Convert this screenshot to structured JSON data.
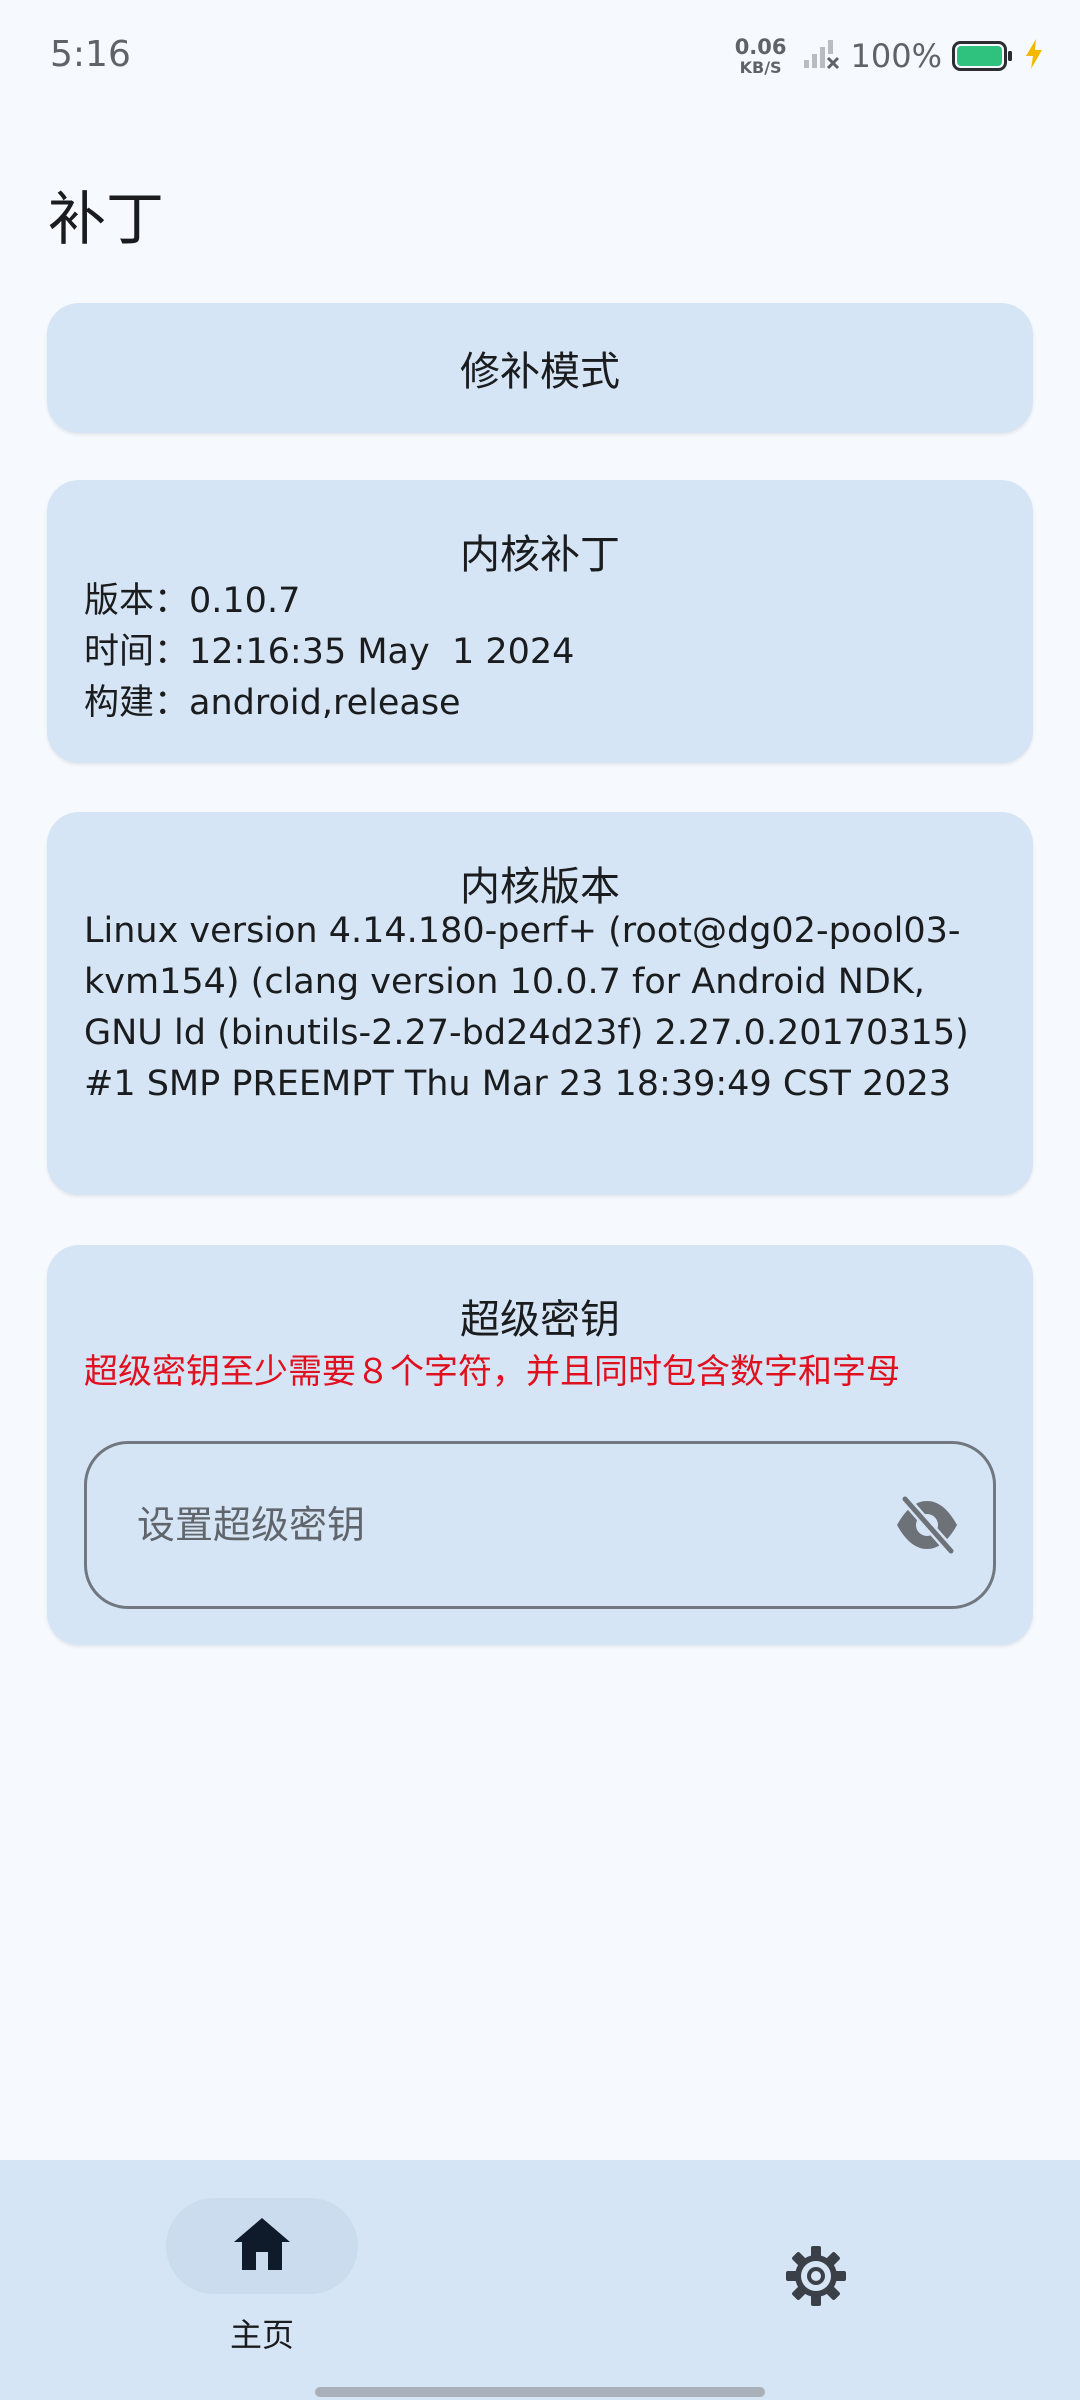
{
  "status_bar": {
    "time": "5:16",
    "net_speed_value": "0.06",
    "net_speed_unit": "KB/S",
    "battery_percent": "100%",
    "battery_level": 1.0,
    "charging": true,
    "colors": {
      "battery": "#2ec27e",
      "bolt": "#f5b800"
    }
  },
  "page": {
    "title": "补丁"
  },
  "mode_card": {
    "label": "修补模式"
  },
  "kpatch_card": {
    "title": "内核补丁",
    "rows": [
      {
        "label": "版本：",
        "value": "0.10.7"
      },
      {
        "label": "时间：",
        "value": "12:16:35 May  1 2024"
      },
      {
        "label": "构建：",
        "value": "android,release"
      }
    ]
  },
  "kernel_card": {
    "title": "内核版本",
    "text": "Linux version 4.14.180-perf+ (root@dg02-pool03-kvm154) (clang version 10.0.7 for Android NDK, GNU ld (binutils-2.27-bd24d23f) 2.27.0.20170315) #1 SMP PREEMPT Thu Mar 23 18:39:49 CST 2023"
  },
  "superkey_card": {
    "title": "超级密钥",
    "warning": "超级密钥至少需要８个字符，并且同时包含数字和字母",
    "input_value": "",
    "input_placeholder": "设置超级密钥",
    "toggle_icon": "eye-off-icon",
    "colors": {
      "warning": "#e0101e"
    }
  },
  "bottom_nav": {
    "items": [
      {
        "label": "主页",
        "icon": "home-icon",
        "selected": true
      },
      {
        "label": "",
        "icon": "settings-icon",
        "selected": false
      }
    ]
  },
  "colors": {
    "background": "#f6f9fe",
    "card": "#d6e5f5",
    "nav_background": "#d6e5f5"
  }
}
